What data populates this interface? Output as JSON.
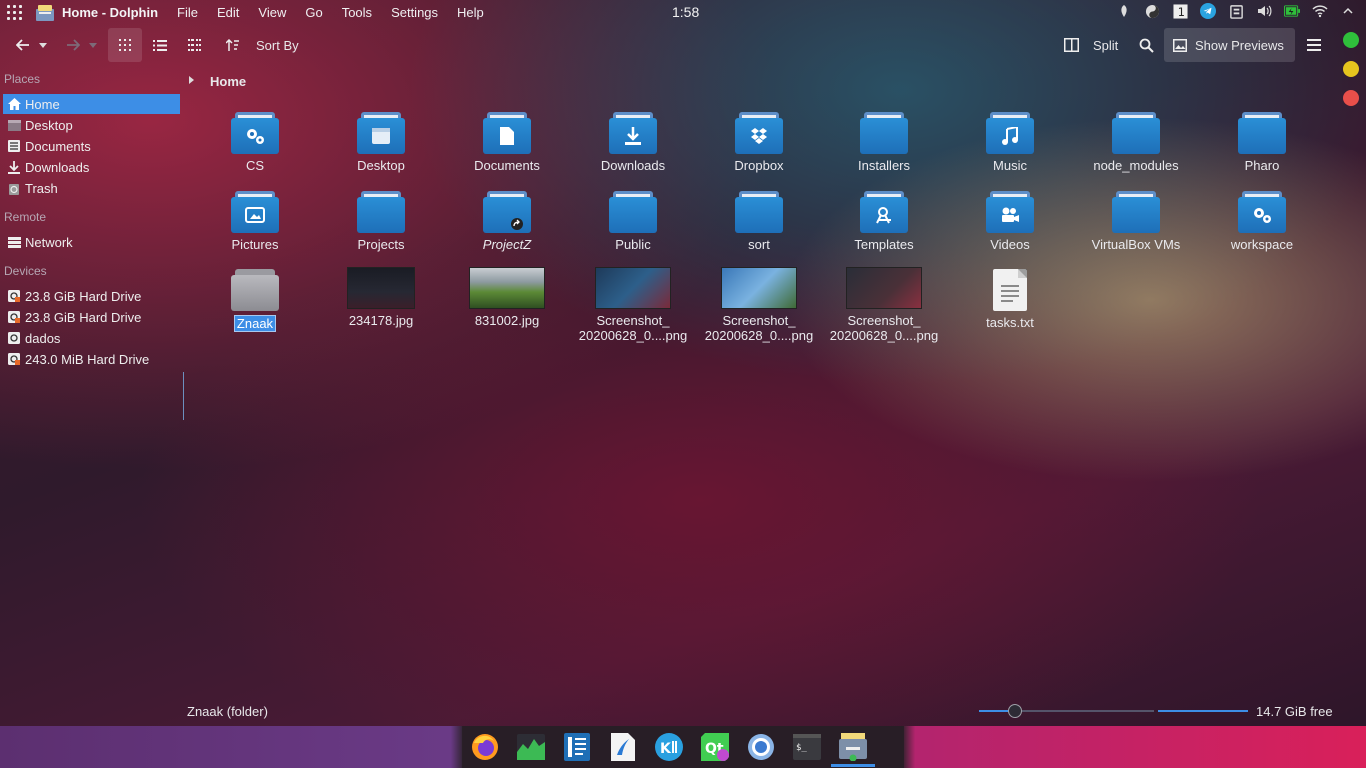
{
  "window": {
    "title": "Home - Dolphin"
  },
  "menubar": [
    "File",
    "Edit",
    "View",
    "Go",
    "Tools",
    "Settings",
    "Help"
  ],
  "clock": "1:58",
  "toolbar": {
    "sort_label": "Sort By",
    "split_label": "Split",
    "preview_label": "Show Previews"
  },
  "sidebar": {
    "places_title": "Places",
    "places": [
      {
        "label": "Home",
        "icon": "home-icon",
        "selected": true
      },
      {
        "label": "Desktop",
        "icon": "desktop-icon"
      },
      {
        "label": "Documents",
        "icon": "documents-icon"
      },
      {
        "label": "Downloads",
        "icon": "downloads-icon"
      },
      {
        "label": "Trash",
        "icon": "trash-icon"
      }
    ],
    "remote_title": "Remote",
    "remote": [
      {
        "label": "Network",
        "icon": "network-icon"
      }
    ],
    "devices_title": "Devices",
    "devices": [
      {
        "label": "23.8 GiB Hard Drive",
        "icon": "harddrive-icon"
      },
      {
        "label": "23.8 GiB Hard Drive",
        "icon": "harddrive-icon"
      },
      {
        "label": "dados",
        "icon": "harddrive-icon"
      },
      {
        "label": "243.0 MiB Hard Drive",
        "icon": "harddrive-icon"
      }
    ]
  },
  "breadcrumb": {
    "current": "Home"
  },
  "files": {
    "row1": [
      "CS",
      "Desktop",
      "Documents",
      "Downloads",
      "Dropbox",
      "Installers",
      "Music",
      "node_modules",
      "Pharo"
    ],
    "row2": [
      "Pictures",
      "Projects",
      "ProjectZ",
      "Public",
      "sort",
      "Templates",
      "Videos",
      "VirtualBox VMs",
      "workspace"
    ],
    "row3": [
      {
        "name": "Znaak",
        "kind": "folder"
      },
      {
        "name": "234178.jpg",
        "kind": "image"
      },
      {
        "name": "831002.jpg",
        "kind": "image"
      },
      {
        "name": "Screenshot_\n20200628_0....png",
        "kind": "image"
      },
      {
        "name": "Screenshot_\n20200628_0....png",
        "kind": "image"
      },
      {
        "name": "Screenshot_\n20200628_0....png",
        "kind": "image"
      },
      {
        "name": "tasks.txt",
        "kind": "text"
      }
    ]
  },
  "statusbar": {
    "selection": "Znaak (folder)",
    "free_space": "14.7 GiB free",
    "zoom_level": 0.2
  },
  "colors": {
    "accent": "#3d8ee6",
    "window_dot_1": "#2fbf3b",
    "window_dot_2": "#e6c51e",
    "window_dot_3": "#e84f4a"
  }
}
